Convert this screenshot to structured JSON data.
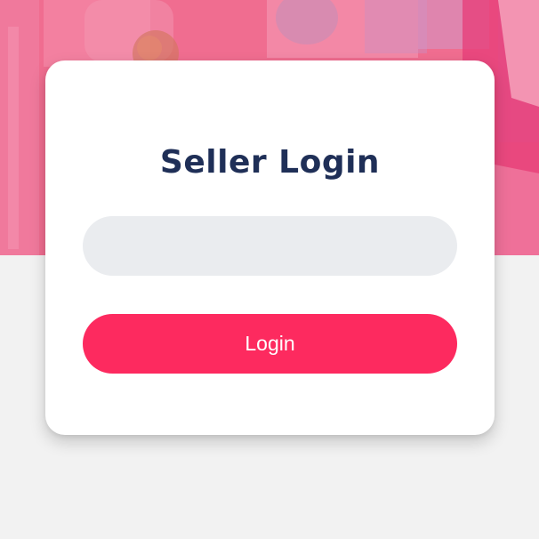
{
  "page": {
    "title": "Seller Login"
  },
  "form": {
    "seller_input_value": "",
    "seller_input_placeholder": "",
    "login_button_label": "Login"
  },
  "colors": {
    "title_color": "#1f2f57",
    "button_color": "#fd2a5f",
    "input_background": "#eaecef",
    "page_background": "#f2f2f2",
    "hero_tint": "#f06d93"
  },
  "icons": {
    "hero_decoration": "blurred-store-background"
  }
}
